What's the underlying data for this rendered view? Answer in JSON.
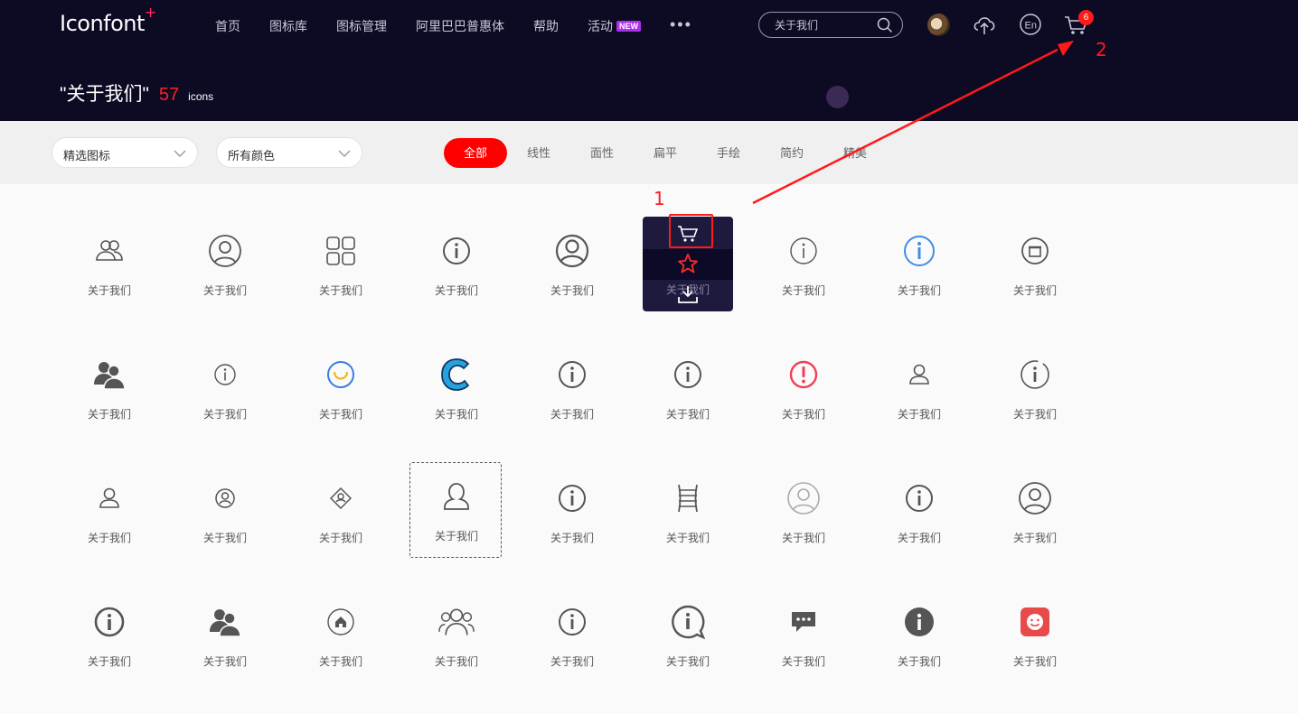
{
  "header": {
    "logo": "Iconfont",
    "logo_mark": "+",
    "nav": [
      {
        "label": "首页"
      },
      {
        "label": "图标库"
      },
      {
        "label": "图标管理"
      },
      {
        "label": "阿里巴巴普惠体"
      },
      {
        "label": "帮助"
      },
      {
        "label": "活动",
        "badge": "NEW"
      }
    ],
    "more": "•••",
    "search_value": "关于我们",
    "cart_count": "6"
  },
  "result": {
    "query": "\"关于我们\"",
    "count": "57",
    "unit": "icons"
  },
  "filters": {
    "select1": "精选图标",
    "select2": "所有颜色",
    "tabs": [
      "全部",
      "线性",
      "面性",
      "扁平",
      "手绘",
      "简约",
      "精美"
    ],
    "active_tab": "全部"
  },
  "icon_label": "关于我们",
  "icons": [
    [
      "users-icon",
      "user-circle-icon",
      "grid-apps-icon",
      "info-icon",
      "user-circle-filled-icon",
      "hover-card",
      "info-thin-icon",
      "info-blue-icon",
      "shop-icon"
    ],
    [
      "users-solid-icon",
      "info-small-icon",
      "smile-face-icon",
      "brand-c-icon",
      "info-icon",
      "info-icon",
      "alert-red-icon",
      "user-small-icon",
      "info-dashed-icon"
    ],
    [
      "user-small-icon",
      "user-badge-icon",
      "user-diamond-icon",
      "user-bust-icon",
      "info-icon",
      "ladder-icon",
      "user-circle-gray-icon",
      "info-icon",
      "user-circle-icon"
    ],
    [
      "info-bold-icon",
      "users-solid-icon",
      "home-circle-icon",
      "group-icon",
      "info-icon",
      "info-chat-icon",
      "chat-bubble-icon",
      "info-filled-icon",
      "smile-red-icon"
    ]
  ],
  "annotations": {
    "label1": "1",
    "label2": "2",
    "color": "#ff1a1a"
  },
  "colors": {
    "header_bg": "#0d0a24",
    "accent": "#ff0000"
  }
}
